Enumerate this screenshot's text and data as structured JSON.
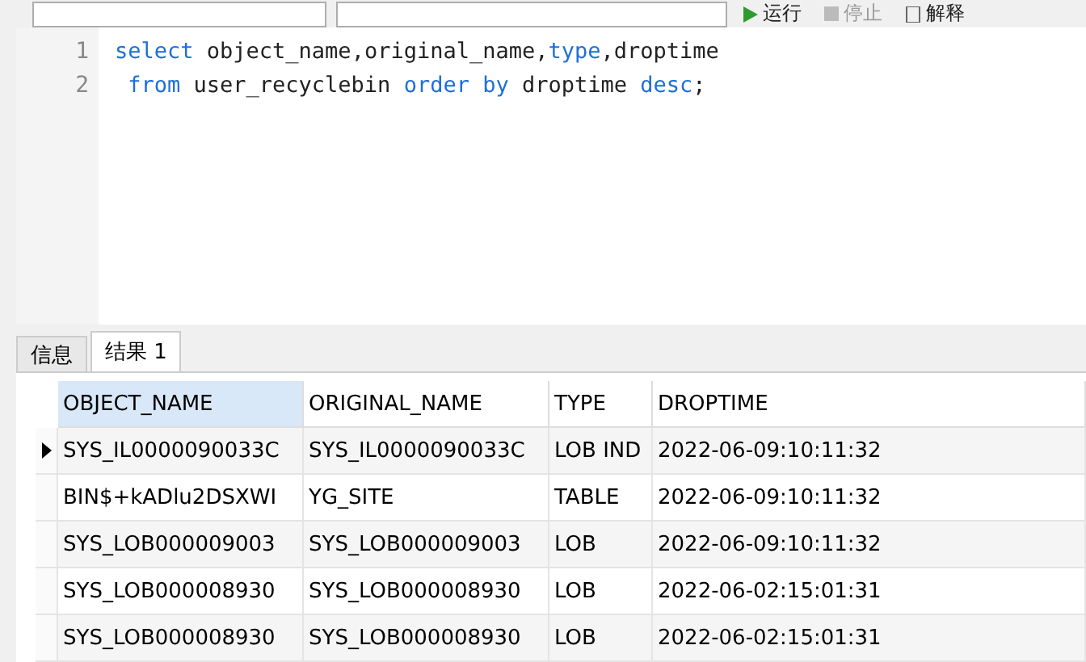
{
  "toolbar": {
    "buttons": [
      {
        "kind": "run",
        "label": "运行",
        "disabled": false
      },
      {
        "kind": "stop",
        "label": "停止",
        "disabled": true
      },
      {
        "kind": "explain",
        "label": "解释",
        "disabled": false
      }
    ]
  },
  "editor": {
    "line_numbers": [
      "1",
      "2"
    ],
    "lines": [
      [
        {
          "t": "select",
          "kw": true
        },
        {
          "t": " object_name,original_name,",
          "kw": false
        },
        {
          "t": "type",
          "kw": true
        },
        {
          "t": ",droptime",
          "kw": false
        }
      ],
      [
        {
          "t": " from",
          "kw": true
        },
        {
          "t": " user_recyclebin ",
          "kw": false
        },
        {
          "t": "order by",
          "kw": true
        },
        {
          "t": " droptime ",
          "kw": false
        },
        {
          "t": "desc",
          "kw": true
        },
        {
          "t": ";",
          "kw": false
        }
      ]
    ]
  },
  "tabs": [
    {
      "label": "信息",
      "selected": false
    },
    {
      "label": "结果 1",
      "selected": true
    }
  ],
  "table": {
    "columns": [
      {
        "label": "OBJECT_NAME",
        "selected": true
      },
      {
        "label": "ORIGINAL_NAME",
        "selected": false
      },
      {
        "label": "TYPE",
        "selected": false
      },
      {
        "label": "DROPTIME",
        "selected": false
      }
    ],
    "rows": [
      {
        "selected": true,
        "cells": [
          "SYS_IL0000090033C",
          "SYS_IL0000090033C",
          "LOB IND",
          "2022-06-09:10:11:32"
        ]
      },
      {
        "selected": false,
        "cells": [
          "BIN$+kADlu2DSXWI",
          "YG_SITE",
          "TABLE",
          "2022-06-09:10:11:32"
        ]
      },
      {
        "selected": false,
        "cells": [
          "SYS_LOB000009003",
          "SYS_LOB000009003",
          "LOB",
          "2022-06-09:10:11:32"
        ]
      },
      {
        "selected": false,
        "cells": [
          "SYS_LOB000008930",
          "SYS_LOB000008930",
          "LOB",
          "2022-06-02:15:01:31"
        ]
      },
      {
        "selected": false,
        "cells": [
          "SYS_LOB000008930",
          "SYS_LOB000008930",
          "LOB",
          "2022-06-02:15:01:31"
        ]
      }
    ]
  }
}
